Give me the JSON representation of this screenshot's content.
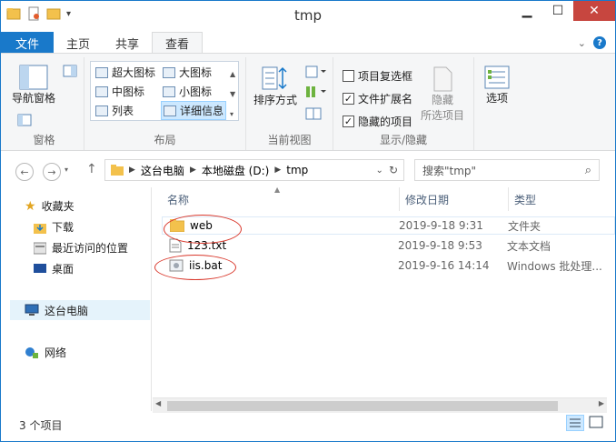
{
  "window": {
    "title": "tmp"
  },
  "tabs": {
    "file": "文件",
    "home": "主页",
    "share": "共享",
    "view": "查看"
  },
  "ribbon": {
    "panes": {
      "nav_pane": "导航窗格",
      "group_label": "窗格"
    },
    "layout": {
      "extra_large": "超大图标",
      "large": "大图标",
      "medium": "中图标",
      "small": "小图标",
      "list": "列表",
      "details": "详细信息",
      "group_label": "布局"
    },
    "current_view": {
      "sort_by": "排序方式",
      "group_label": "当前视图"
    },
    "show_hide": {
      "item_checkboxes": "项目复选框",
      "file_extensions": "文件扩展名",
      "hidden_items": "隐藏的项目",
      "hide_selected_line1": "隐藏",
      "hide_selected_line2": "所选项目",
      "options": "选项",
      "group_label": "显示/隐藏",
      "item_checkboxes_checked": false,
      "file_extensions_checked": true,
      "hidden_items_checked": true
    }
  },
  "address": {
    "crumbs": [
      "这台电脑",
      "本地磁盘 (D:)",
      "tmp"
    ],
    "search_placeholder": "搜索\"tmp\""
  },
  "nav": {
    "favorites": "收藏夹",
    "downloads": "下载",
    "recent": "最近访问的位置",
    "desktop": "桌面",
    "this_pc": "这台电脑",
    "network": "网络"
  },
  "columns": {
    "name": "名称",
    "date": "修改日期",
    "type": "类型"
  },
  "files": [
    {
      "name": "web",
      "date": "2019-9-18 9:31",
      "type": "文件夹",
      "icon": "folder-icon"
    },
    {
      "name": "123.txt",
      "date": "2019-9-18 9:53",
      "type": "文本文档",
      "icon": "text-file-icon"
    },
    {
      "name": "iis.bat",
      "date": "2019-9-16 14:14",
      "type": "Windows 批处理...",
      "icon": "batch-file-icon"
    }
  ],
  "status": {
    "item_count": "3 个项目"
  },
  "colors": {
    "accent": "#1979ca",
    "annotation": "#d9382c",
    "folder": "#f3c14c"
  }
}
